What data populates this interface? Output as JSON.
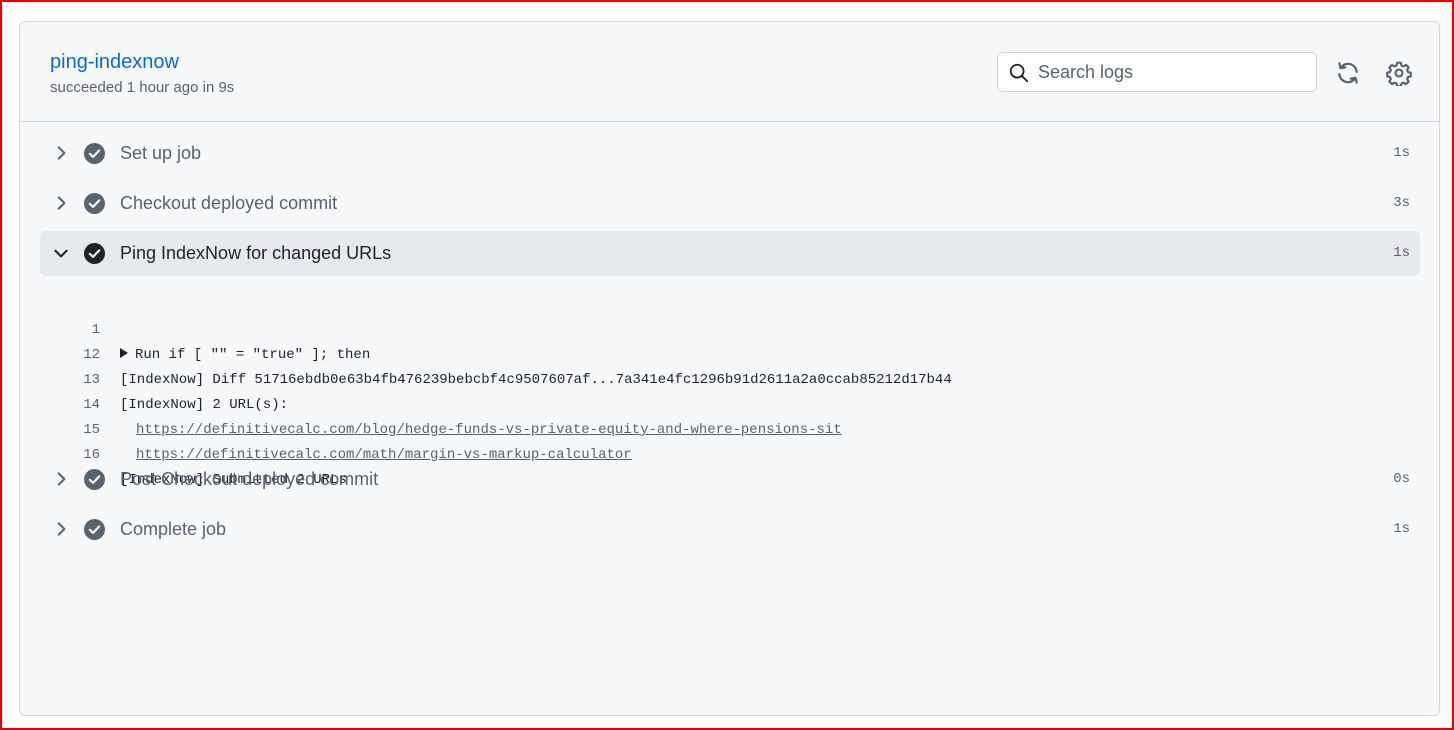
{
  "job": {
    "title": "ping-indexnow",
    "status": "succeeded 1 hour ago in 9s"
  },
  "search": {
    "placeholder": "Search logs"
  },
  "steps": [
    {
      "name": "Set up job",
      "duration": "1s",
      "expanded": false
    },
    {
      "name": "Checkout deployed commit",
      "duration": "3s",
      "expanded": false
    },
    {
      "name": "Ping IndexNow for changed URLs",
      "duration": "1s",
      "expanded": true
    },
    {
      "name": "Post Checkout deployed commit",
      "duration": "0s",
      "expanded": false
    },
    {
      "name": "Complete job",
      "duration": "1s",
      "expanded": false
    }
  ],
  "log": [
    {
      "num": "1",
      "text": "Run if [ \"\" = \"true\" ]; then"
    },
    {
      "num": "12",
      "text": "[IndexNow] Diff 51716ebdb0e63b4fb476239bebcbf4c9507607af...7a341e4fc1296b91d2611a2a0ccab85212d17b44"
    },
    {
      "num": "13",
      "text": "[IndexNow] 2 URL(s):"
    },
    {
      "num": "14",
      "text": "https://definitivecalc.com/blog/hedge-funds-vs-private-equity-and-where-pensions-sit"
    },
    {
      "num": "15",
      "text": "https://definitivecalc.com/math/margin-vs-markup-calculator"
    },
    {
      "num": "16",
      "text": "[IndexNow] Submitted 2 URLs"
    }
  ],
  "colors": {
    "accent": "#0969da",
    "check": "#59636e",
    "check_active": "#1f2328",
    "frame": "#e60000"
  }
}
